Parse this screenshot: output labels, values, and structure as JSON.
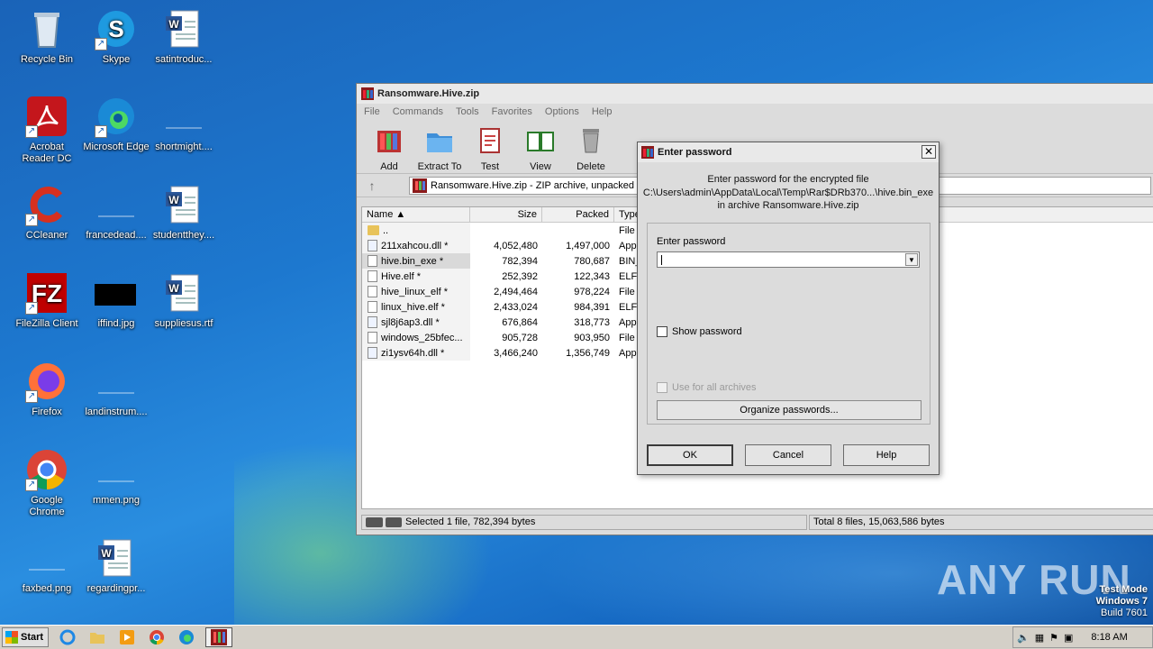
{
  "desktop": {
    "icons": [
      {
        "label": "Recycle Bin",
        "icon": "recycle-bin-icon"
      },
      {
        "label": "Skype",
        "icon": "skype-icon"
      },
      {
        "label": "satintroduc...",
        "icon": "word-doc-icon"
      },
      {
        "label": "Acrobat Reader DC",
        "icon": "acrobat-icon"
      },
      {
        "label": "Microsoft Edge",
        "icon": "edge-icon"
      },
      {
        "label": "shortmight....",
        "icon": "blank-file-icon"
      },
      {
        "label": "CCleaner",
        "icon": "ccleaner-icon"
      },
      {
        "label": "francedead....",
        "icon": "blank-file-icon"
      },
      {
        "label": "studentthey....",
        "icon": "word-doc-icon"
      },
      {
        "label": "FileZilla Client",
        "icon": "filezilla-icon"
      },
      {
        "label": "iffind.jpg",
        "icon": "image-file-icon"
      },
      {
        "label": "suppliesus.rtf",
        "icon": "word-doc-icon"
      },
      {
        "label": "Firefox",
        "icon": "firefox-icon"
      },
      {
        "label": "landinstrum....",
        "icon": "blank-file-icon"
      },
      {
        "label": "Google Chrome",
        "icon": "chrome-icon"
      },
      {
        "label": "mmen.png",
        "icon": "blank-file-icon"
      },
      {
        "label": "faxbed.png",
        "icon": "blank-file-icon"
      },
      {
        "label": "regardingpr...",
        "icon": "word-doc-icon"
      }
    ]
  },
  "winrar": {
    "title": "Ransomware.Hive.zip",
    "menu": [
      "File",
      "Commands",
      "Tools",
      "Favorites",
      "Options",
      "Help"
    ],
    "toolbar": [
      "Add",
      "Extract To",
      "Test",
      "View",
      "Delete"
    ],
    "address": "Ransomware.Hive.zip - ZIP archive, unpacked si",
    "columns": {
      "name": "Name",
      "size": "Size",
      "packed": "Packed",
      "type": "Type"
    },
    "files": [
      {
        "name": "..",
        "size": "",
        "packed": "",
        "type": "File",
        "kind": "folder"
      },
      {
        "name": "211xahcou.dll *",
        "size": "4,052,480",
        "packed": "1,497,000",
        "type": "Appl",
        "kind": "dll"
      },
      {
        "name": "hive.bin_exe *",
        "size": "782,394",
        "packed": "780,687",
        "type": "BIN_",
        "kind": "file"
      },
      {
        "name": "Hive.elf *",
        "size": "252,392",
        "packed": "122,343",
        "type": "ELF",
        "kind": "file"
      },
      {
        "name": "hive_linux_elf *",
        "size": "2,494,464",
        "packed": "978,224",
        "type": "File",
        "kind": "file"
      },
      {
        "name": "linux_hive.elf *",
        "size": "2,433,024",
        "packed": "984,391",
        "type": "ELF",
        "kind": "file"
      },
      {
        "name": "sjl8j6ap3.dll *",
        "size": "676,864",
        "packed": "318,773",
        "type": "Appl",
        "kind": "dll"
      },
      {
        "name": "windows_25bfec...",
        "size": "905,728",
        "packed": "903,950",
        "type": "File",
        "kind": "file"
      },
      {
        "name": "zi1ysv64h.dll *",
        "size": "3,466,240",
        "packed": "1,356,749",
        "type": "Appl",
        "kind": "dll"
      }
    ],
    "status_left": "Selected 1 file, 782,394 bytes",
    "status_right": "Total 8 files, 15,063,586 bytes"
  },
  "dialog": {
    "title": "Enter password",
    "close": "✕",
    "msg1": "Enter password for the encrypted file",
    "msg2": "C:\\Users\\admin\\AppData\\Local\\Temp\\Rar$DRb370...\\hive.bin_exe",
    "msg3": "in archive Ransomware.Hive.zip",
    "pw_label": "Enter password",
    "pw_value": "",
    "show_password": "Show password",
    "use_all": "Use for all archives",
    "organize": "Organize passwords...",
    "ok": "OK",
    "cancel": "Cancel",
    "help": "Help"
  },
  "watermark": "ANY RUN",
  "testmode": {
    "line1": "Test Mode",
    "line2": "Windows 7",
    "line3": "Build 7601"
  },
  "taskbar": {
    "start": "Start",
    "clock": "8:18 AM"
  }
}
